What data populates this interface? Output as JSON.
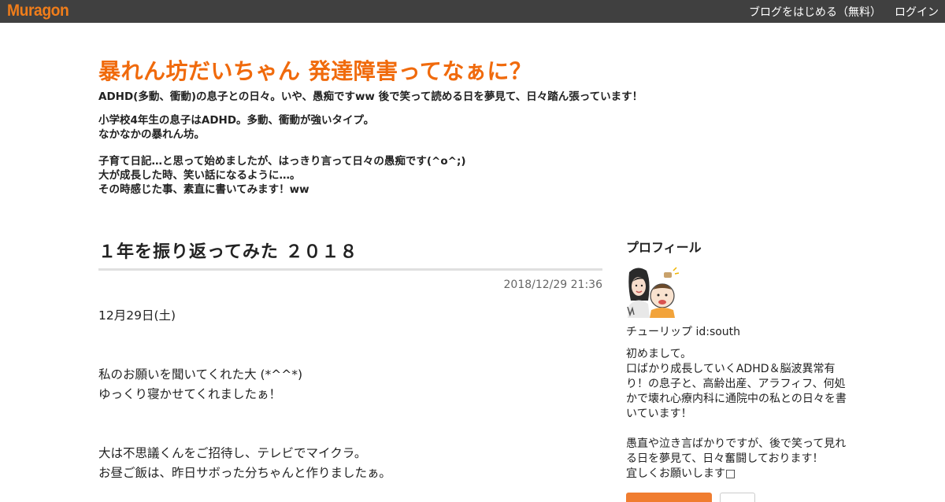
{
  "topbar": {
    "logo": "Muragon",
    "nav": [
      {
        "label": "ブログをはじめる（無料）"
      },
      {
        "label": "ログイン"
      }
    ]
  },
  "blog": {
    "title": "暴れん坊だいちゃん 発達障害ってなぁに？",
    "tagline": "ADHD(多動、衝動)の息子との日々。いや、愚痴ですww  後で笑って読める日を夢見て、日々踏ん張っています！",
    "description": [
      [
        "小学校4年生の息子はADHD。多動、衝動が強いタイプ。",
        "なかなかの暴れん坊。"
      ],
      [
        "子育て日記…と思って始めましたが、はっきり言って日々の愚痴です(^o^;)",
        "大が成長した時、笑い話になるように…。",
        "その時感じた事、素直に書いてみます！ww"
      ]
    ]
  },
  "article": {
    "title": "１年を振り返ってみた ２０１８",
    "date": "2018/12/29 21:36",
    "body": [
      [
        "12月29日(土)"
      ],
      [
        "私のお願いを聞いてくれた大 (*^^*)",
        "ゆっくり寝かせてくれましたぁ！"
      ],
      [
        "大は不思議くんをご招待し、テレビでマイクラ。",
        "お昼ご飯は、昨日サボった分ちゃんと作りましたぁ。"
      ]
    ]
  },
  "sidebar": {
    "heading": "プロフィール",
    "profile_name": "チューリップ  id:south",
    "profile_text": [
      [
        "初めまして。",
        "口ばかり成長していくADHD＆脳波異常有り！の息子と、高齢出産、アラフィフ、何処かで壊れ心療内科に通院中の私との日々を書いています！"
      ],
      [
        "愚直や泣き言ばかりですが、後で笑って見れる日を夢見て、日々奮闘しております！",
        "宜しくお願いします□"
      ]
    ]
  },
  "colors": {
    "accent": "#f06a0c",
    "topbar": "#404040",
    "follow_button": "#f07d30"
  }
}
